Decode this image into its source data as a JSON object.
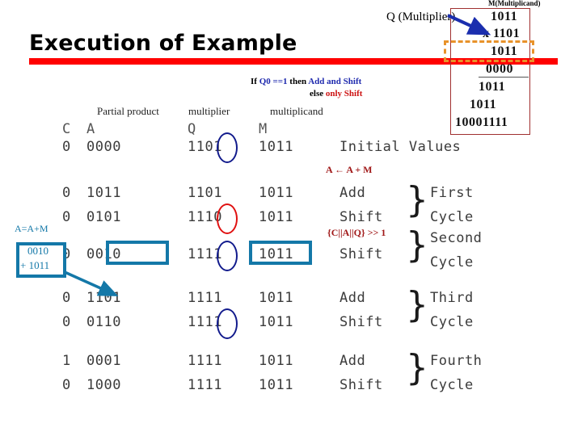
{
  "slide": {
    "title": "Execution of Example"
  },
  "callouts": {
    "q_multiplier": "Q (Multiplier)",
    "m_multiplicand": "M(Multiplicand)",
    "arrow_q_to_m": "arrow-icon",
    "arrow_aam_to_row": "arrow-icon"
  },
  "condition": {
    "line1_part1": "If ",
    "line1_part2": "Q0 ==1",
    "line1_part3": " then ",
    "line1_part4": "Add and Shift",
    "line2_part1": "else ",
    "line2_part2": "only Shift"
  },
  "multiplication": {
    "rows": [
      "1011",
      "x 1101",
      "1011",
      "0000",
      "1011",
      "1011",
      "10001111"
    ],
    "highlighted_row_index": 2
  },
  "captions": {
    "partial_product": "Partial product",
    "multiplier": "multiplier",
    "multiplicand": "multiplicand"
  },
  "table": {
    "headers": [
      "C",
      "A",
      "Q",
      "M"
    ],
    "rows": [
      {
        "c": "0",
        "a": "0000",
        "q": "1101",
        "m": "1011",
        "op": "Initial Values",
        "cycle": ""
      },
      {
        "c": "0",
        "a": "1011",
        "q": "1101",
        "m": "1011",
        "op": "Add",
        "cycle": "First"
      },
      {
        "c": "0",
        "a": "0101",
        "q": "1110",
        "m": "1011",
        "op": "Shift",
        "cycle": "Cycle"
      },
      {
        "c": "0",
        "a": "0010",
        "q": "1111",
        "m": "1011",
        "op": "Shift",
        "cycle": "Second"
      },
      {
        "c": "0",
        "a": "1101",
        "q": "1111",
        "m": "1011",
        "op": "Add",
        "cycle": "Cycle"
      },
      {
        "c": "0",
        "a": "0110",
        "q": "1111",
        "m": "1011",
        "op": "Shift",
        "cycle": "Third"
      },
      {
        "c": "1",
        "a": "0001",
        "q": "1111",
        "m": "1011",
        "op": "Add",
        "cycle": "Cycle"
      },
      {
        "c": "0",
        "a": "1000",
        "q": "1111",
        "m": "1011",
        "op": "Shift",
        "cycle": "Fourth"
      }
    ],
    "cycle_labels": [
      "First",
      "Cycle",
      "Second",
      "Cycle",
      "Third",
      "Cycle",
      "Fourth",
      "Cycle"
    ]
  },
  "annotations": {
    "a_gets_a_plus_m": "A ← A + M",
    "shift_expr": "{C||A||Q} >> 1",
    "aam_label": "A=A+M",
    "aam_value_1": "0010",
    "aam_value_2": "+ 1011"
  },
  "colors": {
    "title_rule": "#FF0000",
    "blue_circle": "#111A8C",
    "red_circle": "#E01010",
    "teal_box": "#1478A8",
    "orange_dashed": "#E8922A",
    "red_annotation": "#A01818",
    "mult_box_border": "#A03030",
    "cond_blue": "#1F2AAE",
    "cond_red": "#CC1111"
  }
}
